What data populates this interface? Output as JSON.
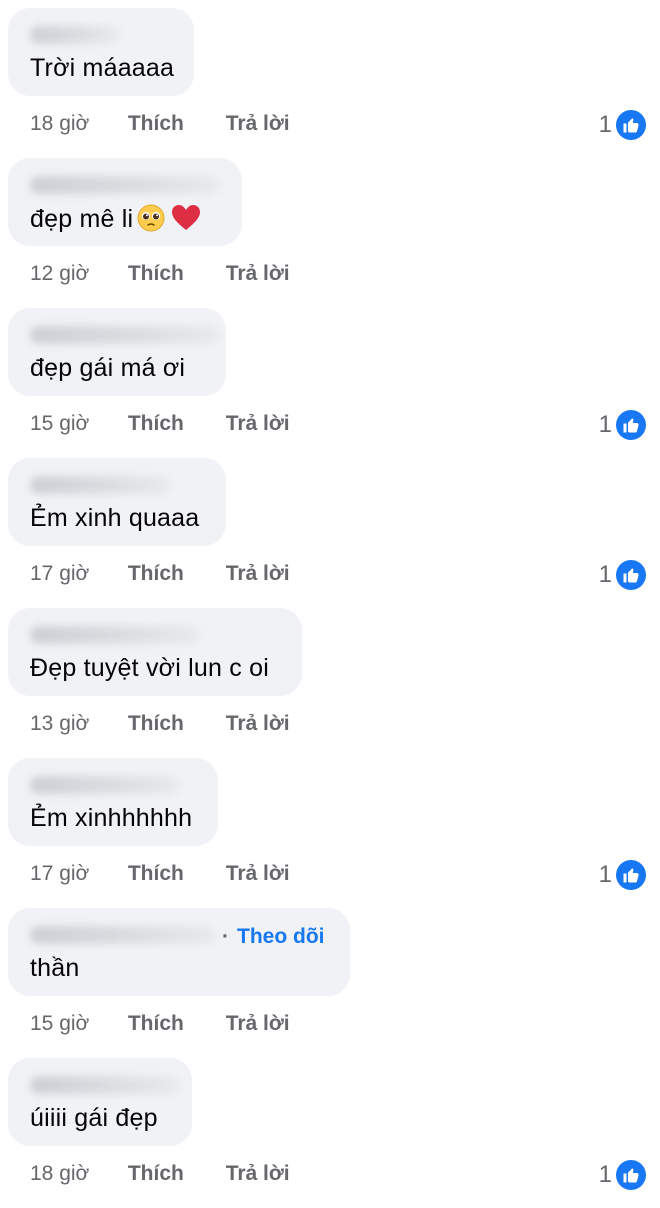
{
  "comments": [
    {
      "text": "Trời máaaaa",
      "time": "18 giờ",
      "like": "Thích",
      "reply": "Trả lời",
      "reactions": "1"
    },
    {
      "text": "đẹp mê li",
      "time": "12 giờ",
      "like": "Thích",
      "reply": "Trả lời",
      "reactions": "",
      "emojis": [
        "pleading-face",
        "red-heart"
      ]
    },
    {
      "text": "đẹp gái má ơi",
      "time": "15 giờ",
      "like": "Thích",
      "reply": "Trả lời",
      "reactions": "1"
    },
    {
      "text": "Ẻm xinh quaaa",
      "time": "17 giờ",
      "like": "Thích",
      "reply": "Trả lời",
      "reactions": "1"
    },
    {
      "text": "Đẹp tuyệt vời lun c oi",
      "time": "13 giờ",
      "like": "Thích",
      "reply": "Trả lời",
      "reactions": ""
    },
    {
      "text": "Ẻm xinhhhhhh",
      "time": "17 giờ",
      "like": "Thích",
      "reply": "Trả lời",
      "reactions": "1"
    },
    {
      "text": "thần",
      "time": "15 giờ",
      "like": "Thích",
      "reply": "Trả lời",
      "reactions": "",
      "follow": "Theo dõi"
    },
    {
      "text": "úiiii gái đẹp",
      "time": "18 giờ",
      "like": "Thích",
      "reply": "Trả lời",
      "reactions": "1"
    }
  ],
  "colors": {
    "bubble": "#f0f2f5",
    "link": "#1877f2",
    "meta": "#65676b",
    "text": "#050505"
  },
  "icons": {
    "reaction": "thumbs-up-icon"
  }
}
